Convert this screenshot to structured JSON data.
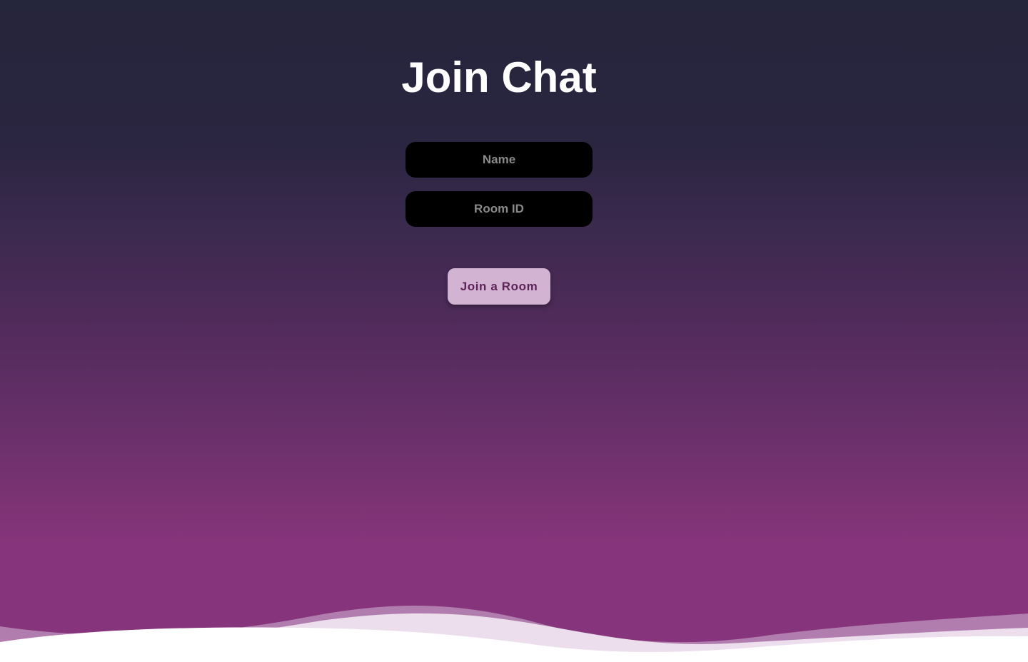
{
  "page": {
    "title": "Join Chat"
  },
  "form": {
    "name_placeholder": "Name",
    "name_value": "",
    "room_placeholder": "Room ID",
    "room_value": "",
    "join_label": "Join a Room"
  },
  "colors": {
    "background_top": "#25253b",
    "background_bottom": "#86347b",
    "input_background": "#000000",
    "button_background": "#d3b3d2",
    "button_text": "#5c2458"
  }
}
